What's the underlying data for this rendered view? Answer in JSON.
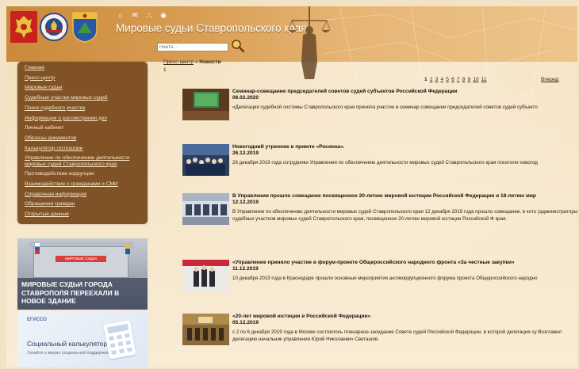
{
  "header": {
    "site_title": "Мировые судьи Ставропольского края",
    "search_placeholder": "Найти...",
    "tool_icons": [
      "home-icon",
      "mail-icon",
      "sitemap-icon",
      "eye-icon"
    ]
  },
  "sidebar": {
    "items": [
      {
        "label": "Главная"
      },
      {
        "label": "Пресс-центр"
      },
      {
        "label": "Мировые судьи"
      },
      {
        "label": "Судебные участки мировых судей"
      },
      {
        "label": "Поиск судебного участка"
      },
      {
        "label": "Информация о рассмотрении дел"
      },
      {
        "label": "Личный кабинет"
      },
      {
        "label": "Образцы документов"
      },
      {
        "label": "Калькулятор госпошлин"
      },
      {
        "label": "Управление по обеспечению деятельности мировых судей Ставропольского края"
      },
      {
        "label": "Противодействие коррупции"
      },
      {
        "label": "Взаимодействие с гражданами и СМИ"
      },
      {
        "label": "Справочная информация"
      },
      {
        "label": "Обращения граждан"
      },
      {
        "label": "Открытые данные"
      }
    ]
  },
  "banners": {
    "relocation": {
      "sign": "МИРОВЫЕ СУДЬИ",
      "caption": "МИРОВЫЕ СУДЬИ ГОРОДА СТАВРОПОЛЯ ПЕРЕЕХАЛИ В НОВОЕ ЗДАНИЕ"
    },
    "calculator": {
      "brand": "ЕГИССО",
      "title": "Социальный калькулятор",
      "subtitle": "Узнайте о мерах социальной поддержки"
    }
  },
  "breadcrumb": {
    "parent": "Пресс-центр",
    "separator": "»",
    "current": "Новости",
    "page": "1"
  },
  "pagination": {
    "pages": [
      "1",
      "2",
      "3",
      "4",
      "5",
      "6",
      "7",
      "8",
      "9",
      "10",
      "11"
    ],
    "active": "1",
    "back_label": "Вперед"
  },
  "news": [
    {
      "title": "Семинар-совещание председателей советов судей субъектов Российской Федерации",
      "date": "06.02.2020",
      "text": "«Делегация судебной системы Ставропольского края приняла участие в семинар совещании председателей советов судей субъекто"
    },
    {
      "title": "Новогодний утренник в приюте «Росинка».",
      "date": "26.12.2019",
      "text": "26 декабря 2019 года сотрудники Управления по обеспечению деятельности мировых судей Ставропольского края посетили новогод"
    },
    {
      "title": "В Управлении прошло совещание посвященное 20-летию мировой юстиции Российской Федерации и 18-летию мир",
      "date": "12.12.2019",
      "text": "В Управлении по обеспечению деятельности мировых судей Ставропольского края 12 декабря 2019 года прошло совещание, в кото (администраторы) судебных участков мировых судей Ставропольского края, посвященное 20-летию мировой юстиции Российской Ф края."
    },
    {
      "title": "«Управление приняло участие в форум-проекте Общероссийского народного фронта «За честные закупки»",
      "date": "11.12.2019",
      "text": "10 декабря 2019 года в Краснодаре прошли основные мероприятия антикоррупционного форума проекта Общероссийского народно"
    },
    {
      "title": "«20-лет мировой юстиции в Российской Федерации»",
      "date": "05.12.2019",
      "text": "с 2 по 6 декабря 2019 года в Москве состоялось пленарное заседание Совета судей Российской Федерации, в которой делегация су Возглавил делегацию начальник управления Юрий Николаевич Светашов."
    }
  ],
  "colors": {
    "header_gradient_start": "#c98a3c",
    "sidebar_bg": "#6f3e10",
    "sidebar_link": "#fbe7c6",
    "page_bg": "#f6e6c9"
  }
}
